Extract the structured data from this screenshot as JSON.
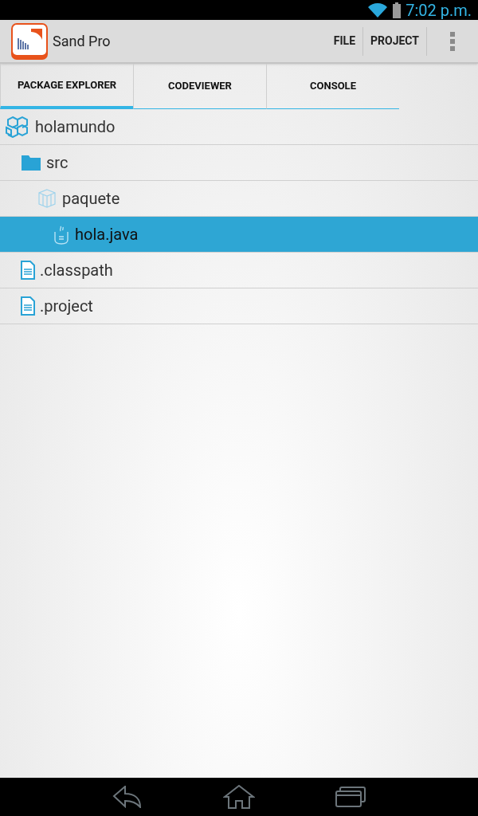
{
  "status_bar": {
    "time": "7:02 p.m."
  },
  "action_bar": {
    "title": "Sand Pro",
    "actions": [
      "FILE",
      "PROJECT"
    ]
  },
  "tabs": [
    {
      "label": "PACKAGE EXPLORER",
      "selected": true
    },
    {
      "label": "CODEVIEWER",
      "selected": false
    },
    {
      "label": "CONSOLE",
      "selected": false
    }
  ],
  "tree": [
    {
      "kind": "project",
      "label": "holamundo",
      "selected": false,
      "children": [
        {
          "kind": "folder",
          "label": "src",
          "selected": false,
          "children": [
            {
              "kind": "package",
              "label": "paquete",
              "selected": false,
              "children": [
                {
                  "kind": "java",
                  "label": "hola.java",
                  "selected": true
                }
              ]
            }
          ]
        },
        {
          "kind": "file",
          "label": ".classpath",
          "selected": false
        },
        {
          "kind": "file",
          "label": ".project",
          "selected": false
        }
      ]
    }
  ]
}
